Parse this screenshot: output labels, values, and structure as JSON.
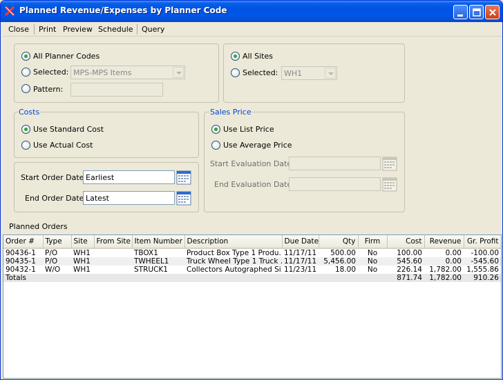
{
  "window": {
    "title": "Planned Revenue/Expenses by Planner Code"
  },
  "menu": {
    "close": "Close",
    "print": "Print",
    "preview": "Preview",
    "schedule": "Schedule",
    "query": "Query"
  },
  "planner": {
    "all_label": "All Planner Codes",
    "selected_label": "Selected:",
    "selected_value": "MPS-MPS Items",
    "pattern_label": "Pattern:",
    "pattern_value": ""
  },
  "sites": {
    "all_label": "All Sites",
    "selected_label": "Selected:",
    "selected_value": "WH1"
  },
  "costs": {
    "title": "Costs",
    "standard_label": "Use Standard Cost",
    "actual_label": "Use Actual Cost"
  },
  "sales_price": {
    "title": "Sales Price",
    "list_label": "Use List Price",
    "average_label": "Use Average Price",
    "start_eval_label": "Start Evaluation Date:",
    "end_eval_label": "End Evaluation Date:",
    "start_eval_value": "",
    "end_eval_value": ""
  },
  "dates": {
    "start_label": "Start Order Date:",
    "start_value": "Earliest",
    "end_label": "End Order Date:",
    "end_value": "Latest"
  },
  "orders": {
    "title": "Planned Orders",
    "columns": [
      "Order #",
      "Type",
      "Site",
      "From Site",
      "Item Number",
      "Description",
      "Due Date",
      "Qty",
      "Firm",
      "Cost",
      "Revenue",
      "Gr. Profit"
    ],
    "rows": [
      [
        "90436-1",
        "P/O",
        "WH1",
        "",
        "TBOX1",
        "Product Box Type 1 Produ...",
        "11/17/11",
        "500.00",
        "No",
        "100.00",
        "0.00",
        "-100.00"
      ],
      [
        "90435-1",
        "P/O",
        "WH1",
        "",
        "TWHEEL1",
        "Truck Wheel Type 1 Truck ...",
        "11/17/11",
        "5,456.00",
        "No",
        "545.60",
        "0.00",
        "-545.60"
      ],
      [
        "90432-1",
        "W/O",
        "WH1",
        "",
        "STRUCK1",
        "Collectors Autographed Si...",
        "11/23/11",
        "18.00",
        "No",
        "226.14",
        "1,782.00",
        "1,555.86"
      ]
    ],
    "totals": {
      "label": "Totals",
      "cost": "871.74",
      "revenue": "1,782.00",
      "profit": "910.26"
    }
  }
}
